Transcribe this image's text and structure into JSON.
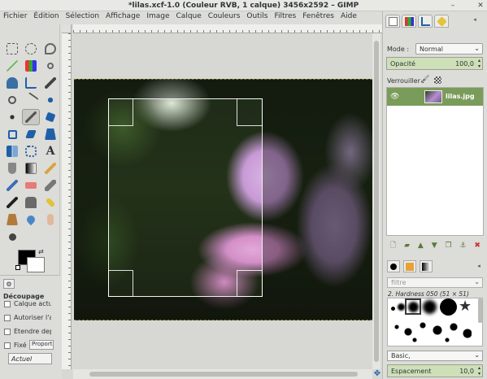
{
  "window": {
    "title": "*lilas.xcf-1.0 (Couleur RVB, 1 calque) 3456x2592 – GIMP"
  },
  "menu": [
    "Fichier",
    "Édition",
    "Sélection",
    "Affichage",
    "Image",
    "Calque",
    "Couleurs",
    "Outils",
    "Filtres",
    "Fenêtres",
    "Aide"
  ],
  "window_controls": {
    "minimize": "–",
    "close": "✕",
    "maximize": "▢"
  },
  "tool_options": {
    "title": "Découpage",
    "checks": [
      "Calque actuel s",
      "Autoriser l'agra",
      "Étendre depuis",
      "Fixé :"
    ],
    "fixed_value": "Proportio",
    "actuel": "Actuel"
  },
  "layers": {
    "mode_label": "Mode :",
    "mode_value": "Normal",
    "opacity_label": "Opacité",
    "opacity_value": "100,0",
    "lock_label": "Verrouiller :",
    "layer_name": "lilas.jpg"
  },
  "brushes": {
    "filter_placeholder": "filtre",
    "current_brush": "2. Hardness 050 (51 × 51)",
    "preset": "Basic,",
    "spacing_label": "Espacement",
    "spacing_value": "10,0"
  }
}
